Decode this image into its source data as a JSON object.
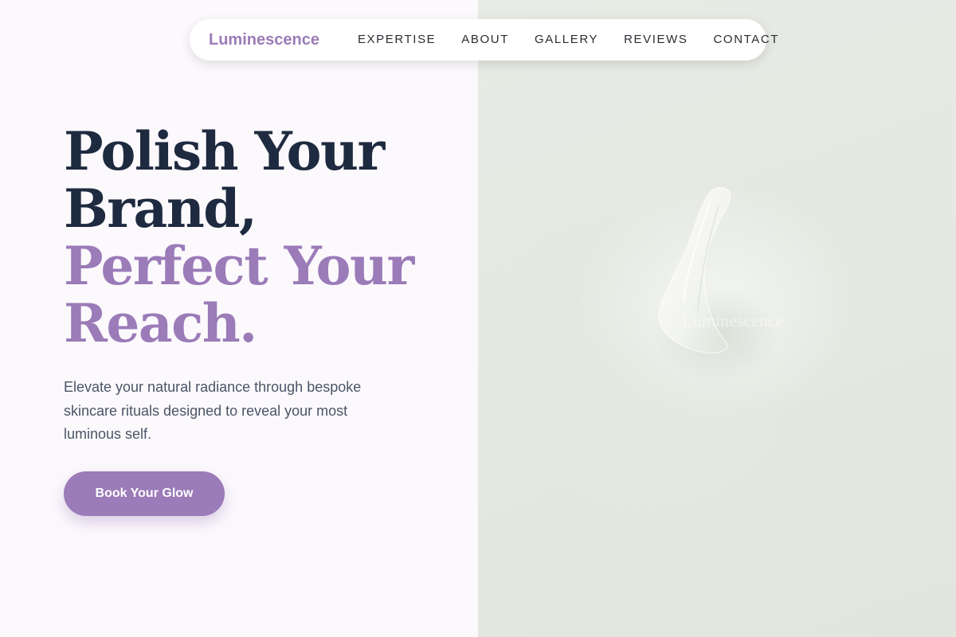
{
  "nav": {
    "brand": "Luminescence",
    "links": [
      "EXPERTISE",
      "ABOUT",
      "GALLERY",
      "REVIEWS",
      "CONTACT"
    ]
  },
  "hero": {
    "headline_line1": "Polish Your",
    "headline_line2": "Brand,",
    "headline_line3": "Perfect Your",
    "headline_line4": "Reach.",
    "subtitle": "Elevate your natural radiance through bespoke skincare rituals designed to reveal your most luminous self.",
    "cta_label": "Book Your Glow"
  },
  "image": {
    "subject": "cream-smear-on-pale-green-background",
    "watermark": "Luminescence"
  },
  "colors": {
    "accent": "#9b7bb8",
    "heading_dark": "#1e2a3f",
    "body_text": "#4a5566",
    "left_background": "#fcf9fd",
    "image_background": "#e6e9e2"
  }
}
